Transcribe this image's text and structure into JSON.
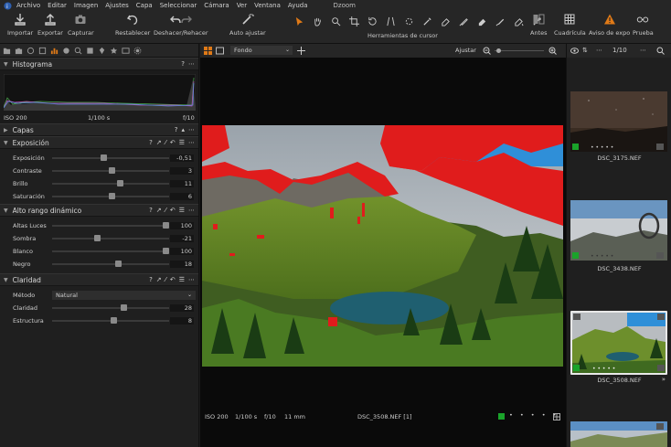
{
  "menubar": {
    "items": [
      "Archivo",
      "Editar",
      "Imagen",
      "Ajustes",
      "Capa",
      "Seleccionar",
      "Cámara",
      "Ver",
      "Ventana",
      "Ayuda"
    ],
    "app_name": "Dzoom"
  },
  "toolbar": {
    "importar": "Importar",
    "exportar": "Exportar",
    "capturar": "Capturar",
    "restablecer": "Restablecer",
    "deshacer": "Deshacer/Rehacer",
    "auto_ajustar": "Auto ajustar",
    "herramientas_cursor": "Herramientas de cursor",
    "antes": "Antes",
    "cuadricula": "Cuadrícula",
    "aviso": "Aviso de expo",
    "prueba": "Prueba"
  },
  "histogram": {
    "title": "Histograma",
    "iso": "ISO 200",
    "shutter": "1/100 s",
    "aperture": "f/10"
  },
  "layers": {
    "title": "Capas"
  },
  "exposure": {
    "title": "Exposición",
    "sliders": [
      {
        "label": "Exposición",
        "value": "-0,51",
        "pos": 0.44
      },
      {
        "label": "Contraste",
        "value": "3",
        "pos": 0.51
      },
      {
        "label": "Brillo",
        "value": "11",
        "pos": 0.58
      },
      {
        "label": "Saturación",
        "value": "6",
        "pos": 0.51
      }
    ]
  },
  "hdr": {
    "title": "Alto rango dinámico",
    "sliders": [
      {
        "label": "Altas Luces",
        "value": "100",
        "pos": 0.97
      },
      {
        "label": "Sombra",
        "value": "-21",
        "pos": 0.39
      },
      {
        "label": "Blanco",
        "value": "100",
        "pos": 0.97
      },
      {
        "label": "Negro",
        "value": "18",
        "pos": 0.57
      }
    ]
  },
  "clarity": {
    "title": "Claridad",
    "method_label": "Método",
    "method_value": "Natural",
    "sliders": [
      {
        "label": "Claridad",
        "value": "28",
        "pos": 0.61
      },
      {
        "label": "Estructura",
        "value": "8",
        "pos": 0.53
      }
    ]
  },
  "viewer": {
    "background": "Fondo",
    "fit_label": "Ajustar",
    "bottom": {
      "iso": "ISO 200",
      "shutter": "1/100 s",
      "aperture": "f/10",
      "focal": "11 mm",
      "filename": "DSC_3508.NEF [1]"
    }
  },
  "browser": {
    "counter": "1/10",
    "thumbnails": [
      {
        "name": "DSC_3175.NEF"
      },
      {
        "name": "DSC_3438.NEF"
      },
      {
        "name": "DSC_3508.NEF"
      }
    ]
  },
  "colors": {
    "accent": "#e07a17",
    "clip": "#e01c1c",
    "rating_green": "#1aa32a"
  }
}
